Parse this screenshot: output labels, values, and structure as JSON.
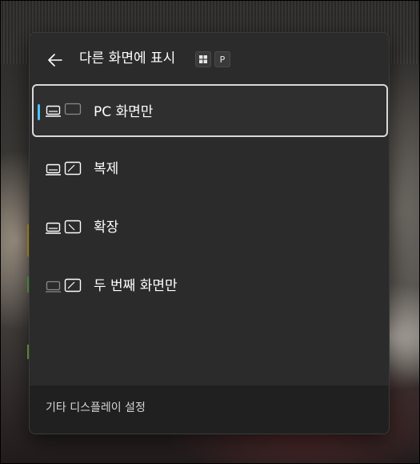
{
  "panel": {
    "title": "다른 화면에 표시",
    "back_icon": "arrow-left-icon",
    "shortcut": {
      "windows_key_icon": "windows-logo-icon",
      "key": "P"
    }
  },
  "options": [
    {
      "label": "PC 화면만",
      "icon": "pc-screen-only-icon",
      "selected": true
    },
    {
      "label": "복제",
      "icon": "duplicate-icon",
      "selected": false
    },
    {
      "label": "확장",
      "icon": "extend-icon",
      "selected": false
    },
    {
      "label": "두 번째 화면만",
      "icon": "second-screen-only-icon",
      "selected": false
    }
  ],
  "footer": {
    "link_label": "기타 디스플레이 설정"
  },
  "colors": {
    "accent": "#4cc2ff",
    "panel_bg": "#2b2b2b",
    "footer_bg": "#202020",
    "selected_border": "#d9d9d9"
  }
}
